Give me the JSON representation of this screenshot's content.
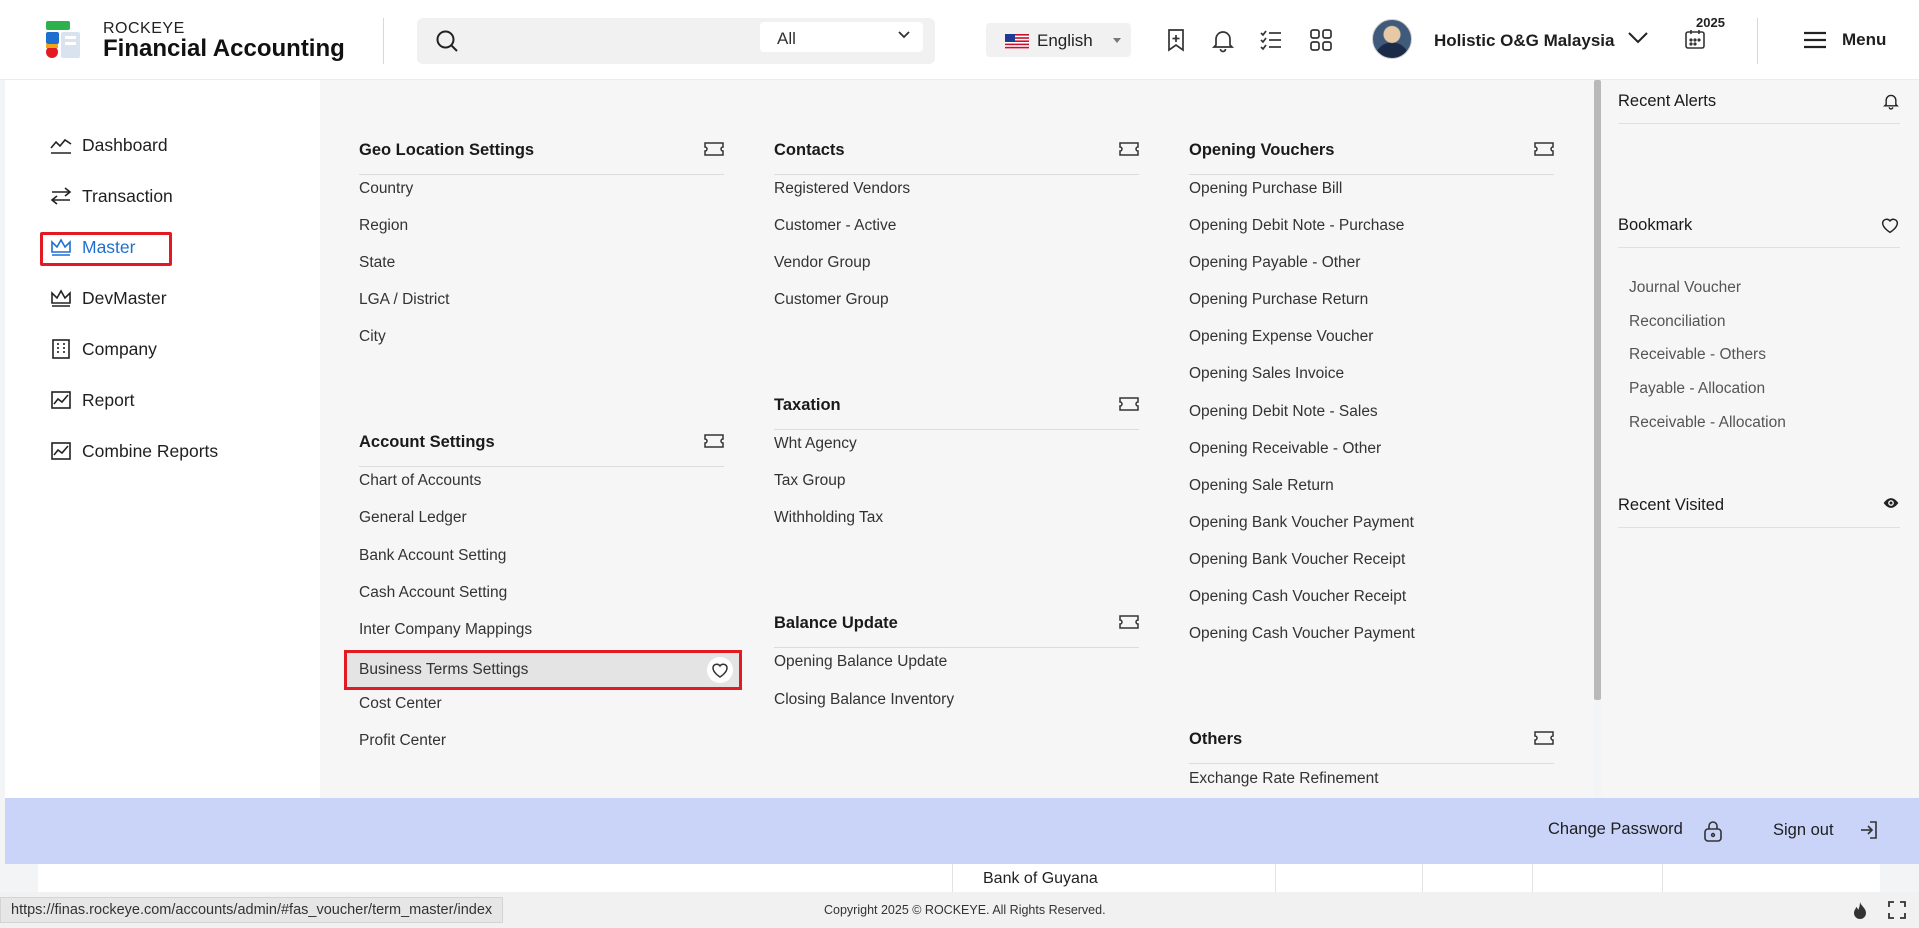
{
  "brand": {
    "small": "ROCKEYE",
    "big": "Financial Accounting",
    "logo_colors": [
      "#2bb24c",
      "#1f6fd1",
      "#e21b23",
      "#f2a516"
    ]
  },
  "header": {
    "search": {
      "placeholder": "",
      "scope_value": "All"
    },
    "language": "English",
    "company": "Holistic O&G Malaysia",
    "year": "2025",
    "menu_label": "Menu",
    "icons": [
      "bookmark-add-icon",
      "bell-icon",
      "checklist-icon",
      "apps-grid-icon",
      "calendar-icon",
      "hamburger-icon"
    ]
  },
  "sidebar": {
    "items": [
      {
        "label": "Dashboard",
        "icon": "chart-line-icon"
      },
      {
        "label": "Transaction",
        "icon": "swap-arrows-icon"
      },
      {
        "label": "Master",
        "icon": "crown-icon",
        "active": true
      },
      {
        "label": "DevMaster",
        "icon": "crown-icon"
      },
      {
        "label": "Company",
        "icon": "building-icon"
      },
      {
        "label": "Report",
        "icon": "report-chart-icon"
      },
      {
        "label": "Combine Reports",
        "icon": "report-chart-icon"
      }
    ]
  },
  "mega_menu": {
    "geo": {
      "title": "Geo Location Settings",
      "links": [
        "Country",
        "Region",
        "State",
        "LGA / District",
        "City"
      ]
    },
    "account": {
      "title": "Account Settings",
      "links": [
        "Chart of Accounts",
        "General Ledger",
        "Bank Account Setting",
        "Cash Account Setting",
        "Inter Company Mappings",
        "Business Terms Settings",
        "Cost Center",
        "Profit Center"
      ]
    },
    "contacts": {
      "title": "Contacts",
      "links": [
        "Registered Vendors",
        "Customer - Active",
        "Vendor Group",
        "Customer Group"
      ]
    },
    "taxation": {
      "title": "Taxation",
      "links": [
        "Wht Agency",
        "Tax Group",
        "Withholding Tax"
      ]
    },
    "balance": {
      "title": "Balance Update",
      "links": [
        "Opening Balance Update",
        "Closing Balance Inventory"
      ]
    },
    "opening": {
      "title": "Opening Vouchers",
      "links": [
        "Opening Purchase Bill",
        "Opening Debit Note - Purchase",
        "Opening Payable - Other",
        "Opening Purchase Return",
        "Opening Expense Voucher",
        "Opening Sales Invoice",
        "Opening Debit Note - Sales",
        "Opening Receivable - Other",
        "Opening Sale Return",
        "Opening Bank Voucher Payment",
        "Opening Bank Voucher Receipt",
        "Opening Cash Voucher Receipt",
        "Opening Cash Voucher Payment"
      ]
    },
    "others": {
      "title": "Others",
      "links": [
        "Exchange Rate Refinement"
      ]
    }
  },
  "right_panel": {
    "alerts_title": "Recent Alerts",
    "bookmark_title": "Bookmark",
    "bookmarks": [
      "Journal Voucher",
      "Reconciliation",
      "Receivable - Others",
      "Payable - Allocation",
      "Receivable - Allocation"
    ],
    "visited_title": "Recent Visited"
  },
  "account_bar": {
    "change_password": "Change Password",
    "sign_out": "Sign out"
  },
  "background_row": {
    "cell": "Bank of Guyana"
  },
  "status": {
    "url": "https://finas.rockeye.com/accounts/admin/#fas_voucher/term_master/index",
    "copyright": "Copyright 2025 © ROCKEYE. All Rights Reserved."
  },
  "colors": {
    "accent_blue": "#1f6fd1",
    "highlight_red": "#e21b23",
    "account_bar": "#c9d4f8"
  }
}
